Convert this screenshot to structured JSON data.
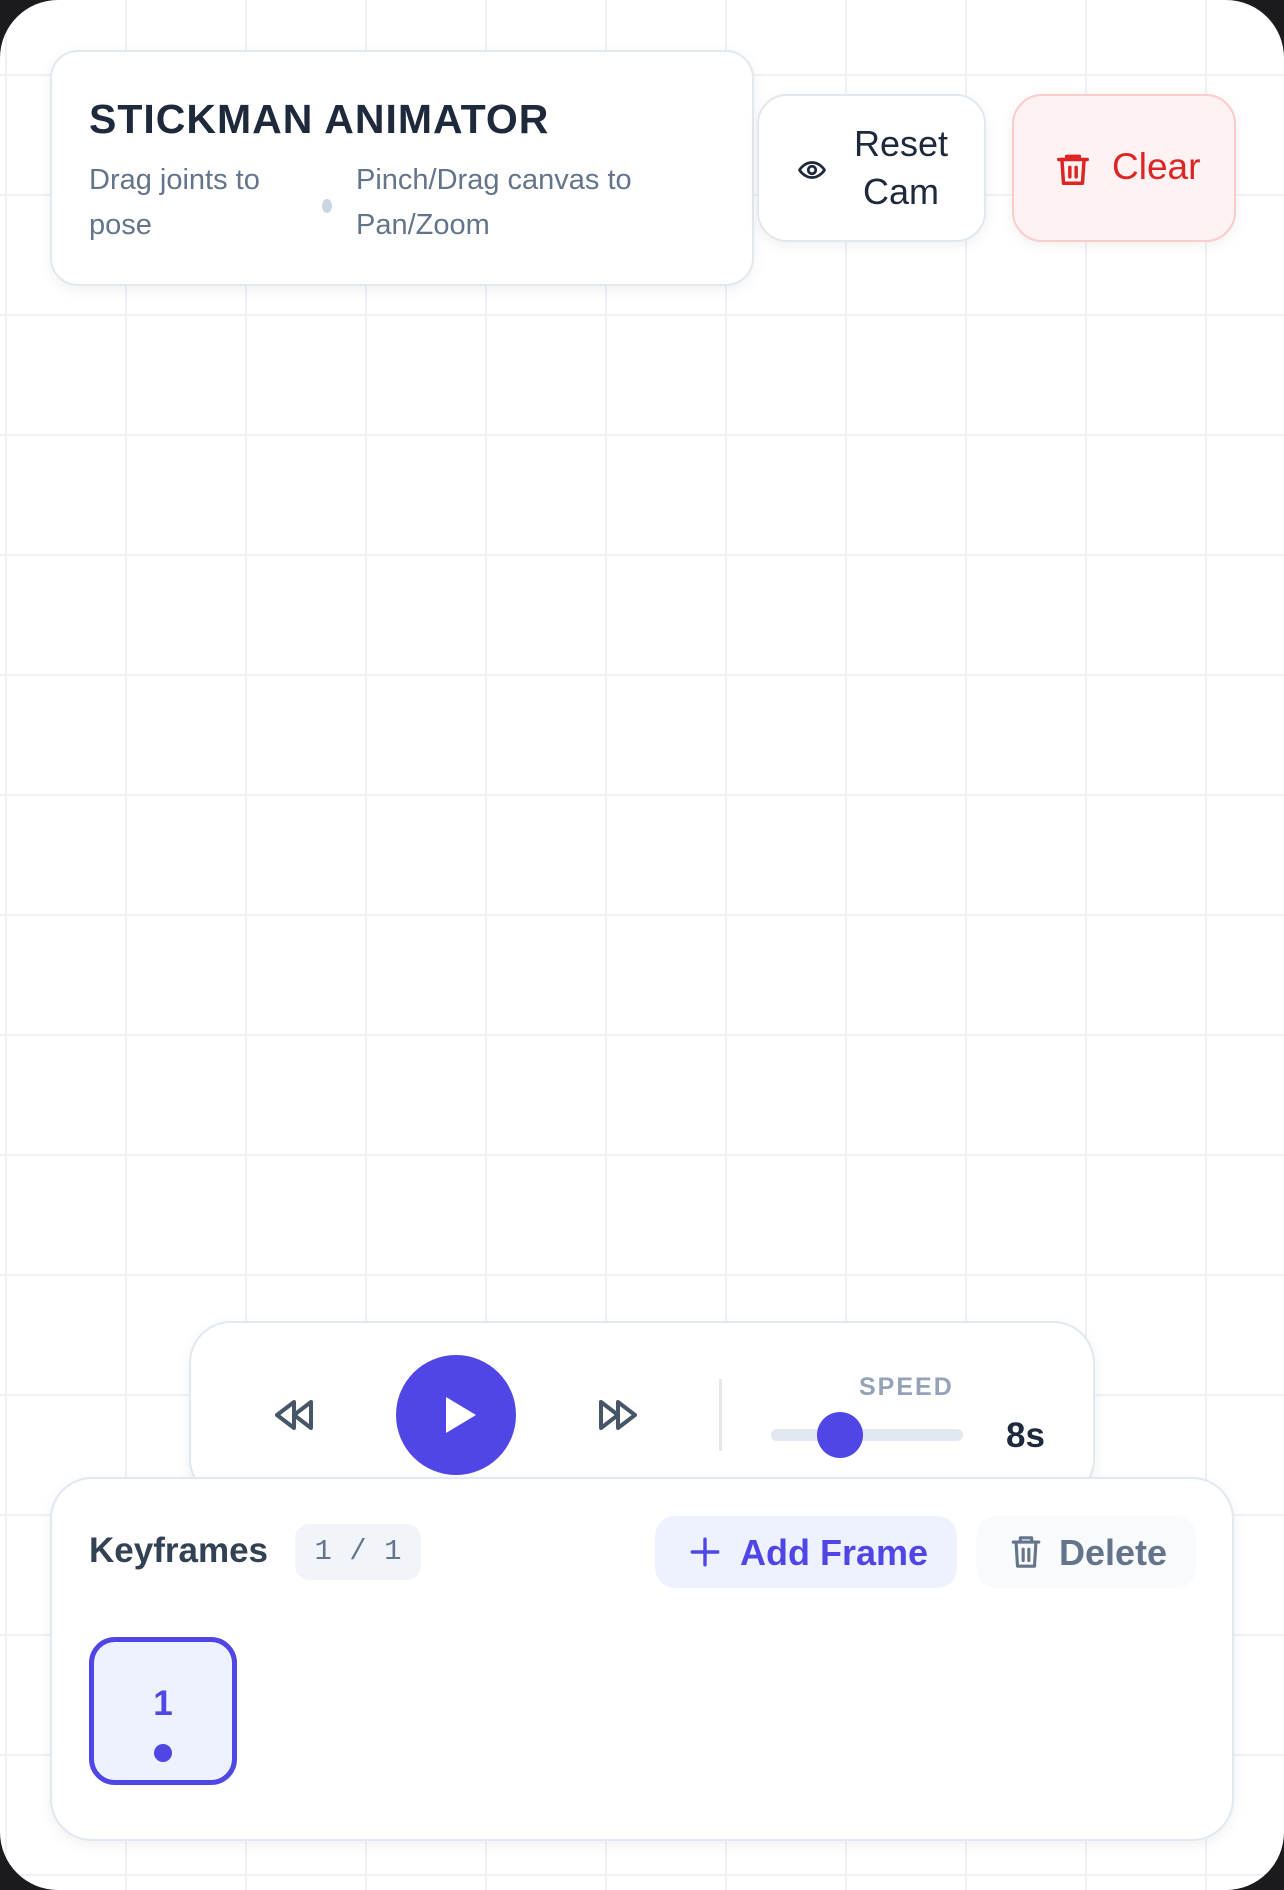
{
  "header": {
    "title": "STICKMAN ANIMATOR",
    "hint_drag": "Drag joints to pose",
    "hint_pan": "Pinch/Drag canvas to Pan/Zoom"
  },
  "toolbar": {
    "reset_label": "Reset Cam",
    "reset_icon": "eye-icon",
    "clear_label": "Clear",
    "clear_icon": "trash-icon"
  },
  "player": {
    "back_icon": "rewind-icon",
    "play_icon": "play-icon",
    "forward_icon": "fast-forward-icon",
    "speed_label": "SPEED",
    "speed_value": "8s",
    "speed_fraction": 0.36
  },
  "keyframes": {
    "title": "Keyframes",
    "count": "1 / 1",
    "add_label": "Add Frame",
    "delete_label": "Delete",
    "frames": [
      {
        "label": "1",
        "active": true
      }
    ]
  },
  "colors": {
    "accent": "#4f46e5",
    "danger": "#dc2626",
    "danger_bg": "#fef2f2",
    "text": "#1e293b",
    "muted": "#64748b"
  }
}
